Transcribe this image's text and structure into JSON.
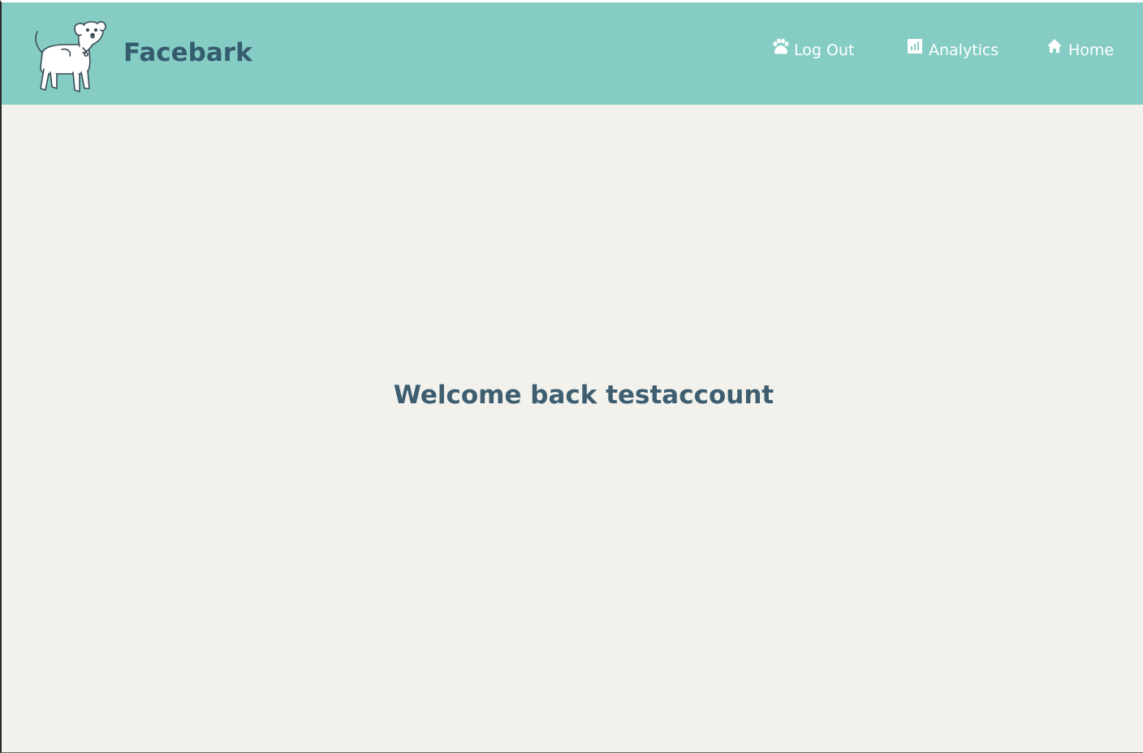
{
  "navbar": {
    "brand": "Facebark",
    "logo_icon": "dog-icon",
    "links": [
      {
        "label": "Log Out",
        "icon": "paw-icon"
      },
      {
        "label": "Analytics",
        "icon": "bar-chart-icon"
      },
      {
        "label": "Home",
        "icon": "home-icon"
      }
    ]
  },
  "main": {
    "welcome": "Welcome back testaccount"
  },
  "colors": {
    "navbar_bg": "#85cdc4",
    "brand_text": "#355b6e",
    "page_bg": "#f2f1ec",
    "nav_text": "#ffffff"
  }
}
